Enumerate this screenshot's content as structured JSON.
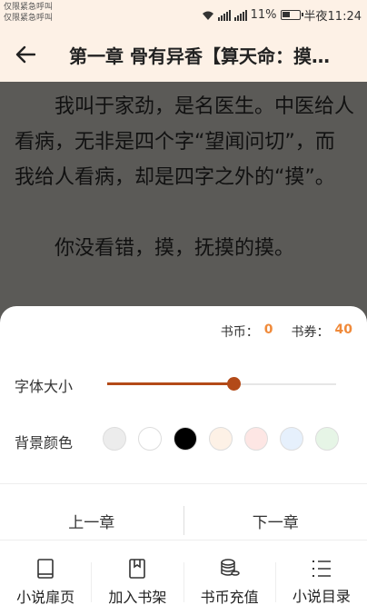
{
  "status_bar": {
    "carrier_line1": "仅限紧急呼叫",
    "carrier_line2": "仅限紧急呼叫",
    "battery_percent": "11%",
    "time": "半夜11:24"
  },
  "header": {
    "chapter_title": "第一章 骨有异香【算天命：摸骨】"
  },
  "content": {
    "paragraphs": [
      "我叫于家劲，是名医生。中医给人看病，无非是四个字“望闻问切”，而我给人看病，却是四字之外的“摸”。",
      "你没看错，摸，抚摸的摸。"
    ]
  },
  "panel": {
    "coin_label": "书币：",
    "coin_value": "0",
    "voucher_label": "书券：",
    "voucher_value": "40",
    "font_size_label": "字体大小",
    "font_size_level": 0.55,
    "bg_color_label": "背景颜色",
    "bg_colors": [
      "#ececec",
      "#ffffff",
      "#000000",
      "#fdf1e6",
      "#fde6e4",
      "#e6f0fc",
      "#e6f5e6"
    ],
    "prev_chapter": "上一章",
    "next_chapter": "下一章"
  },
  "tabs": [
    {
      "label": "小说扉页",
      "icon": "book-icon"
    },
    {
      "label": "加入书架",
      "icon": "bookmark-icon"
    },
    {
      "label": "书币充值",
      "icon": "coins-icon"
    },
    {
      "label": "小说目录",
      "icon": "list-icon"
    }
  ]
}
